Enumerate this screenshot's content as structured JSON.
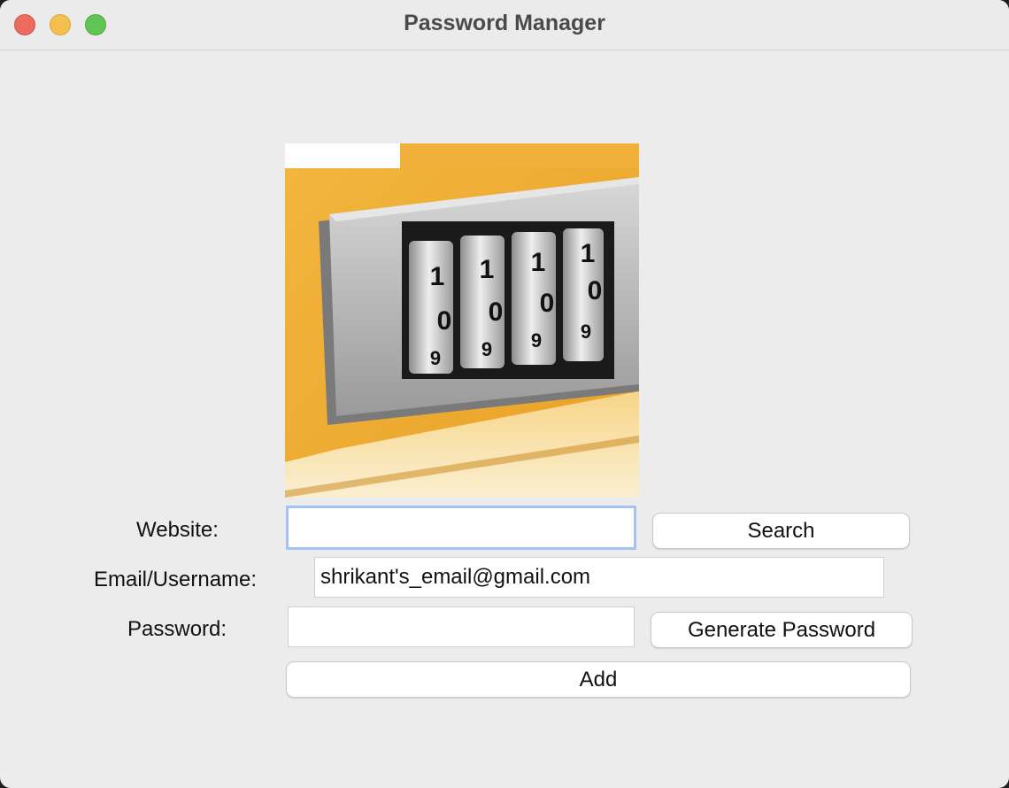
{
  "window": {
    "title": "Password Manager"
  },
  "logo": {
    "icon": "combination-lock-icon",
    "digits_top": [
      "1",
      "1",
      "1",
      "1"
    ],
    "digits_middle": [
      "0",
      "0",
      "0",
      "0"
    ],
    "digits_bottom": [
      "9",
      "9",
      "9",
      "9"
    ]
  },
  "form": {
    "website_label": "Website:",
    "website_value": "",
    "email_label": "Email/Username:",
    "email_value": "shrikant's_email@gmail.com",
    "password_label": "Password:",
    "password_value": ""
  },
  "buttons": {
    "search": "Search",
    "generate": "Generate Password",
    "add": "Add"
  }
}
